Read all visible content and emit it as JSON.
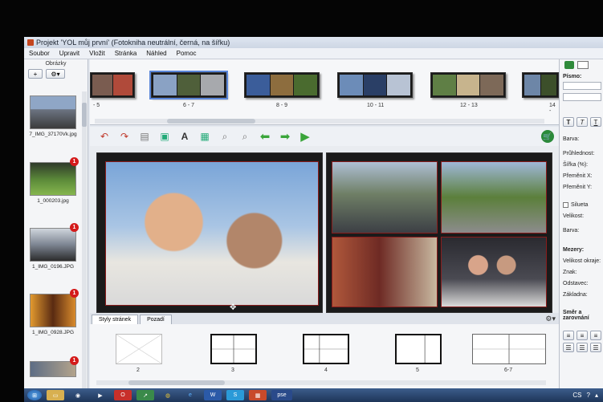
{
  "window": {
    "title": "Projekt 'YOL můj první' (Fotokniha neutrální, černá, na šířku)"
  },
  "menu": [
    "Soubor",
    "Upravit",
    "Vložit",
    "Stránka",
    "Náhled",
    "Pomoc"
  ],
  "left_panel": {
    "title": "Obrázky",
    "add_label": "+",
    "items": [
      {
        "filename": "7_IMG_37170Vk.jpg",
        "badge": ""
      },
      {
        "filename": "1_000203.jpg",
        "badge": "1"
      },
      {
        "filename": "1_IMG_0196.JPG",
        "badge": "1"
      },
      {
        "filename": "1_IMG_0928.JPG",
        "badge": "1"
      },
      {
        "filename": "",
        "badge": "1"
      }
    ]
  },
  "spreads": [
    "- 5",
    "6 - 7",
    "8 - 9",
    "10 - 11",
    "12 - 13",
    "14 -"
  ],
  "bottom_tabs": [
    "Styly stránek",
    "Pozadí"
  ],
  "page_styles": [
    "2",
    "3",
    "4",
    "5",
    "6-7"
  ],
  "right_panel": {
    "font_label": "Písmo:",
    "text_buttons": [
      "T",
      "T",
      "T"
    ],
    "color_label": "Barva:",
    "opacity_label": "Průhlednost:",
    "width_label": "Šířka (%):",
    "move_x_label": "Přeměnit X:",
    "move_y_label": "Přeměnit Y:",
    "silhouette_label": "Silueta",
    "size_label": "Velikost:",
    "color2_label": "Barva:",
    "spacing_label": "Mezery:",
    "edge_label": "Velikost okraje:",
    "char_label": "Znak:",
    "paragraph_label": "Odstavec:",
    "base_label": "Základna:",
    "align_label": "Směr a zarovnání"
  },
  "taskbar": {
    "lang": "CS",
    "apps": [
      "pse"
    ]
  }
}
